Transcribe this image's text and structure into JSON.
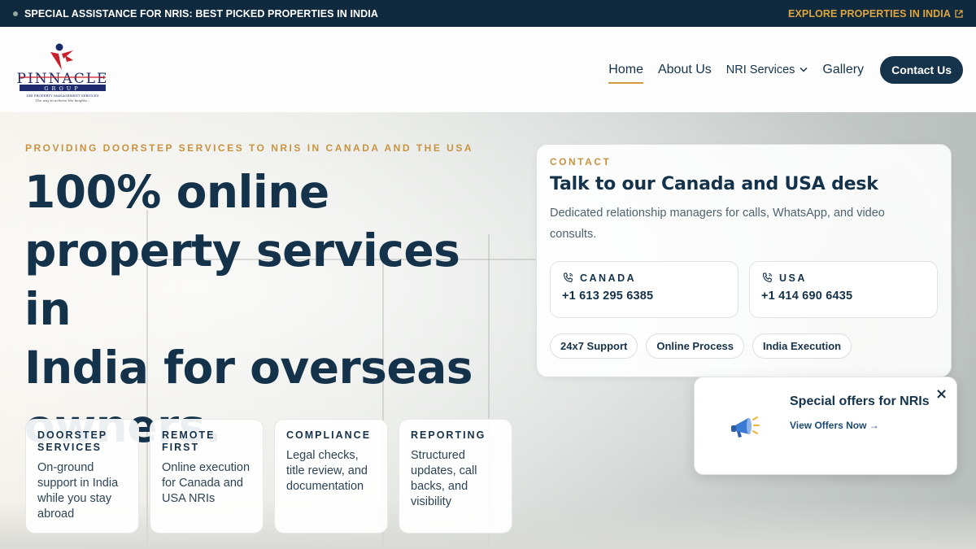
{
  "topbar": {
    "announcement": "SPECIAL ASSISTANCE FOR NRIS: BEST PICKED PROPERTIES IN INDIA",
    "explore_link": "EXPLORE PROPERTIES IN INDIA"
  },
  "logo": {
    "brand": "PINNACLE",
    "group": "GROUP",
    "tagline": "NRI PROPERTY MANAGEMENT SERVICES",
    "motto": "The way to achieve the heights..."
  },
  "nav": {
    "home": "Home",
    "about": "About Us",
    "services": "NRI Services",
    "gallery": "Gallery",
    "contact": "Contact Us"
  },
  "hero": {
    "eyebrow": "PROVIDING DOORSTEP SERVICES TO NRIS IN CANADA AND THE USA",
    "headline_lines": [
      "100% online",
      "property services in",
      "India for overseas",
      "owners."
    ]
  },
  "features": [
    {
      "title": "DOORSTEP SERVICES",
      "desc": "On-ground support in India while you stay abroad"
    },
    {
      "title": "REMOTE FIRST",
      "desc": "Online execution for Canada and USA NRIs"
    },
    {
      "title": "COMPLIANCE",
      "desc": "Legal checks, title review, and documentation"
    },
    {
      "title": "REPORTING",
      "desc": "Structured updates, call backs, and visibility"
    }
  ],
  "contact_card": {
    "eyebrow": "CONTACT",
    "title": "Talk to our Canada and USA desk",
    "subtitle": "Dedicated relationship managers for calls, WhatsApp, and video consults.",
    "phones": [
      {
        "label": "CANADA",
        "number": "+1 613 295 6385"
      },
      {
        "label": "USA",
        "number": "+1 414 690 6435"
      }
    ],
    "chips": [
      "24x7 Support",
      "Online Process",
      "India Execution"
    ]
  },
  "offers": {
    "title": "Special offers for NRIs",
    "link": "View Offers Now →",
    "close": "×"
  },
  "colors": {
    "navy": "#14324a",
    "gold": "#c79341",
    "topbar_bg": "#0f2a3f",
    "logo_red": "#c8202a",
    "logo_navy": "#1d2a6b"
  }
}
